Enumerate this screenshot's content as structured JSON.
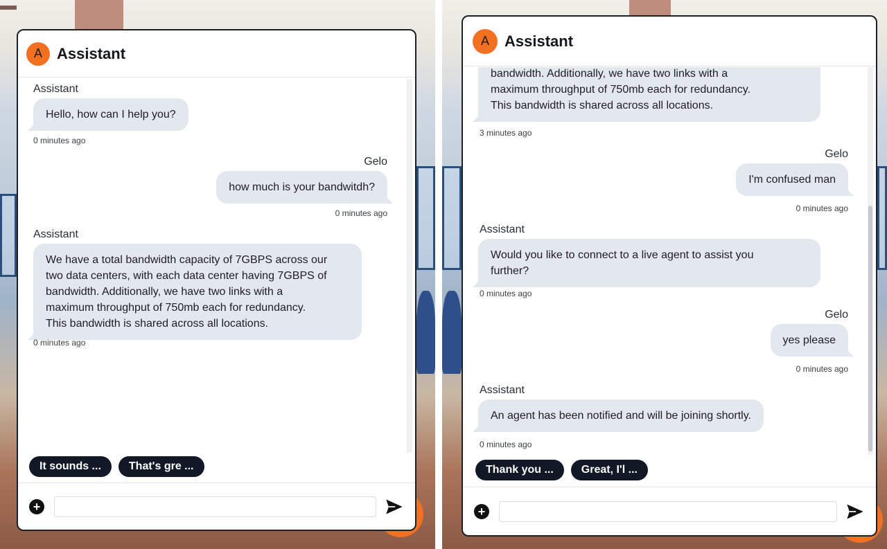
{
  "left": {
    "header": {
      "avatar_letter": "A",
      "title": "Assistant"
    },
    "messages": [
      {
        "role": "bot",
        "sender": "Assistant",
        "lines": [
          "Hello, how can I help you?"
        ],
        "time": "0 minutes ago"
      },
      {
        "role": "user",
        "sender": "Gelo",
        "lines": [
          "how much is your bandwitdh?"
        ],
        "time": "0 minutes ago"
      },
      {
        "role": "bot",
        "sender": "Assistant",
        "lines": [
          "We have a total bandwidth capacity of 7GBPS across our",
          "two data centers, with each data center having 7GBPS of",
          "bandwidth. Additionally, we have two links with a",
          "maximum throughput of 750mb each for redundancy.",
          "This bandwidth is shared across all locations."
        ],
        "time": "0 minutes ago"
      }
    ],
    "quick_replies": [
      "It sounds ...",
      "That's gre ..."
    ],
    "composer": {
      "placeholder": ""
    }
  },
  "right": {
    "header": {
      "avatar_letter": "A",
      "title": "Assistant"
    },
    "messages": [
      {
        "role": "bot",
        "sender": "",
        "lines": [
          "bandwidth. Additionally, we have two links with a",
          "maximum throughput of 750mb each for redundancy.",
          "This bandwidth is shared across all locations."
        ],
        "time": "3 minutes ago"
      },
      {
        "role": "user",
        "sender": "Gelo",
        "lines": [
          "I'm confused man"
        ],
        "time": "0 minutes ago"
      },
      {
        "role": "bot",
        "sender": "Assistant",
        "lines": [
          "Would you like to connect to a live agent to assist you",
          "further?"
        ],
        "time": "0 minutes ago"
      },
      {
        "role": "user",
        "sender": "Gelo",
        "lines": [
          "yes please"
        ],
        "time": "0 minutes ago"
      },
      {
        "role": "bot",
        "sender": "Assistant",
        "lines": [
          "An agent has been notified and will be joining shortly."
        ],
        "time": "0 minutes ago"
      }
    ],
    "quick_replies": [
      "Thank you ...",
      "Great, I'l ..."
    ],
    "composer": {
      "placeholder": ""
    }
  },
  "icons": {
    "add": "plus-icon",
    "send": "send-arrow-icon"
  },
  "colors": {
    "accent": "#f37021",
    "bubble": "#e3e8ef",
    "chip": "#121826"
  }
}
